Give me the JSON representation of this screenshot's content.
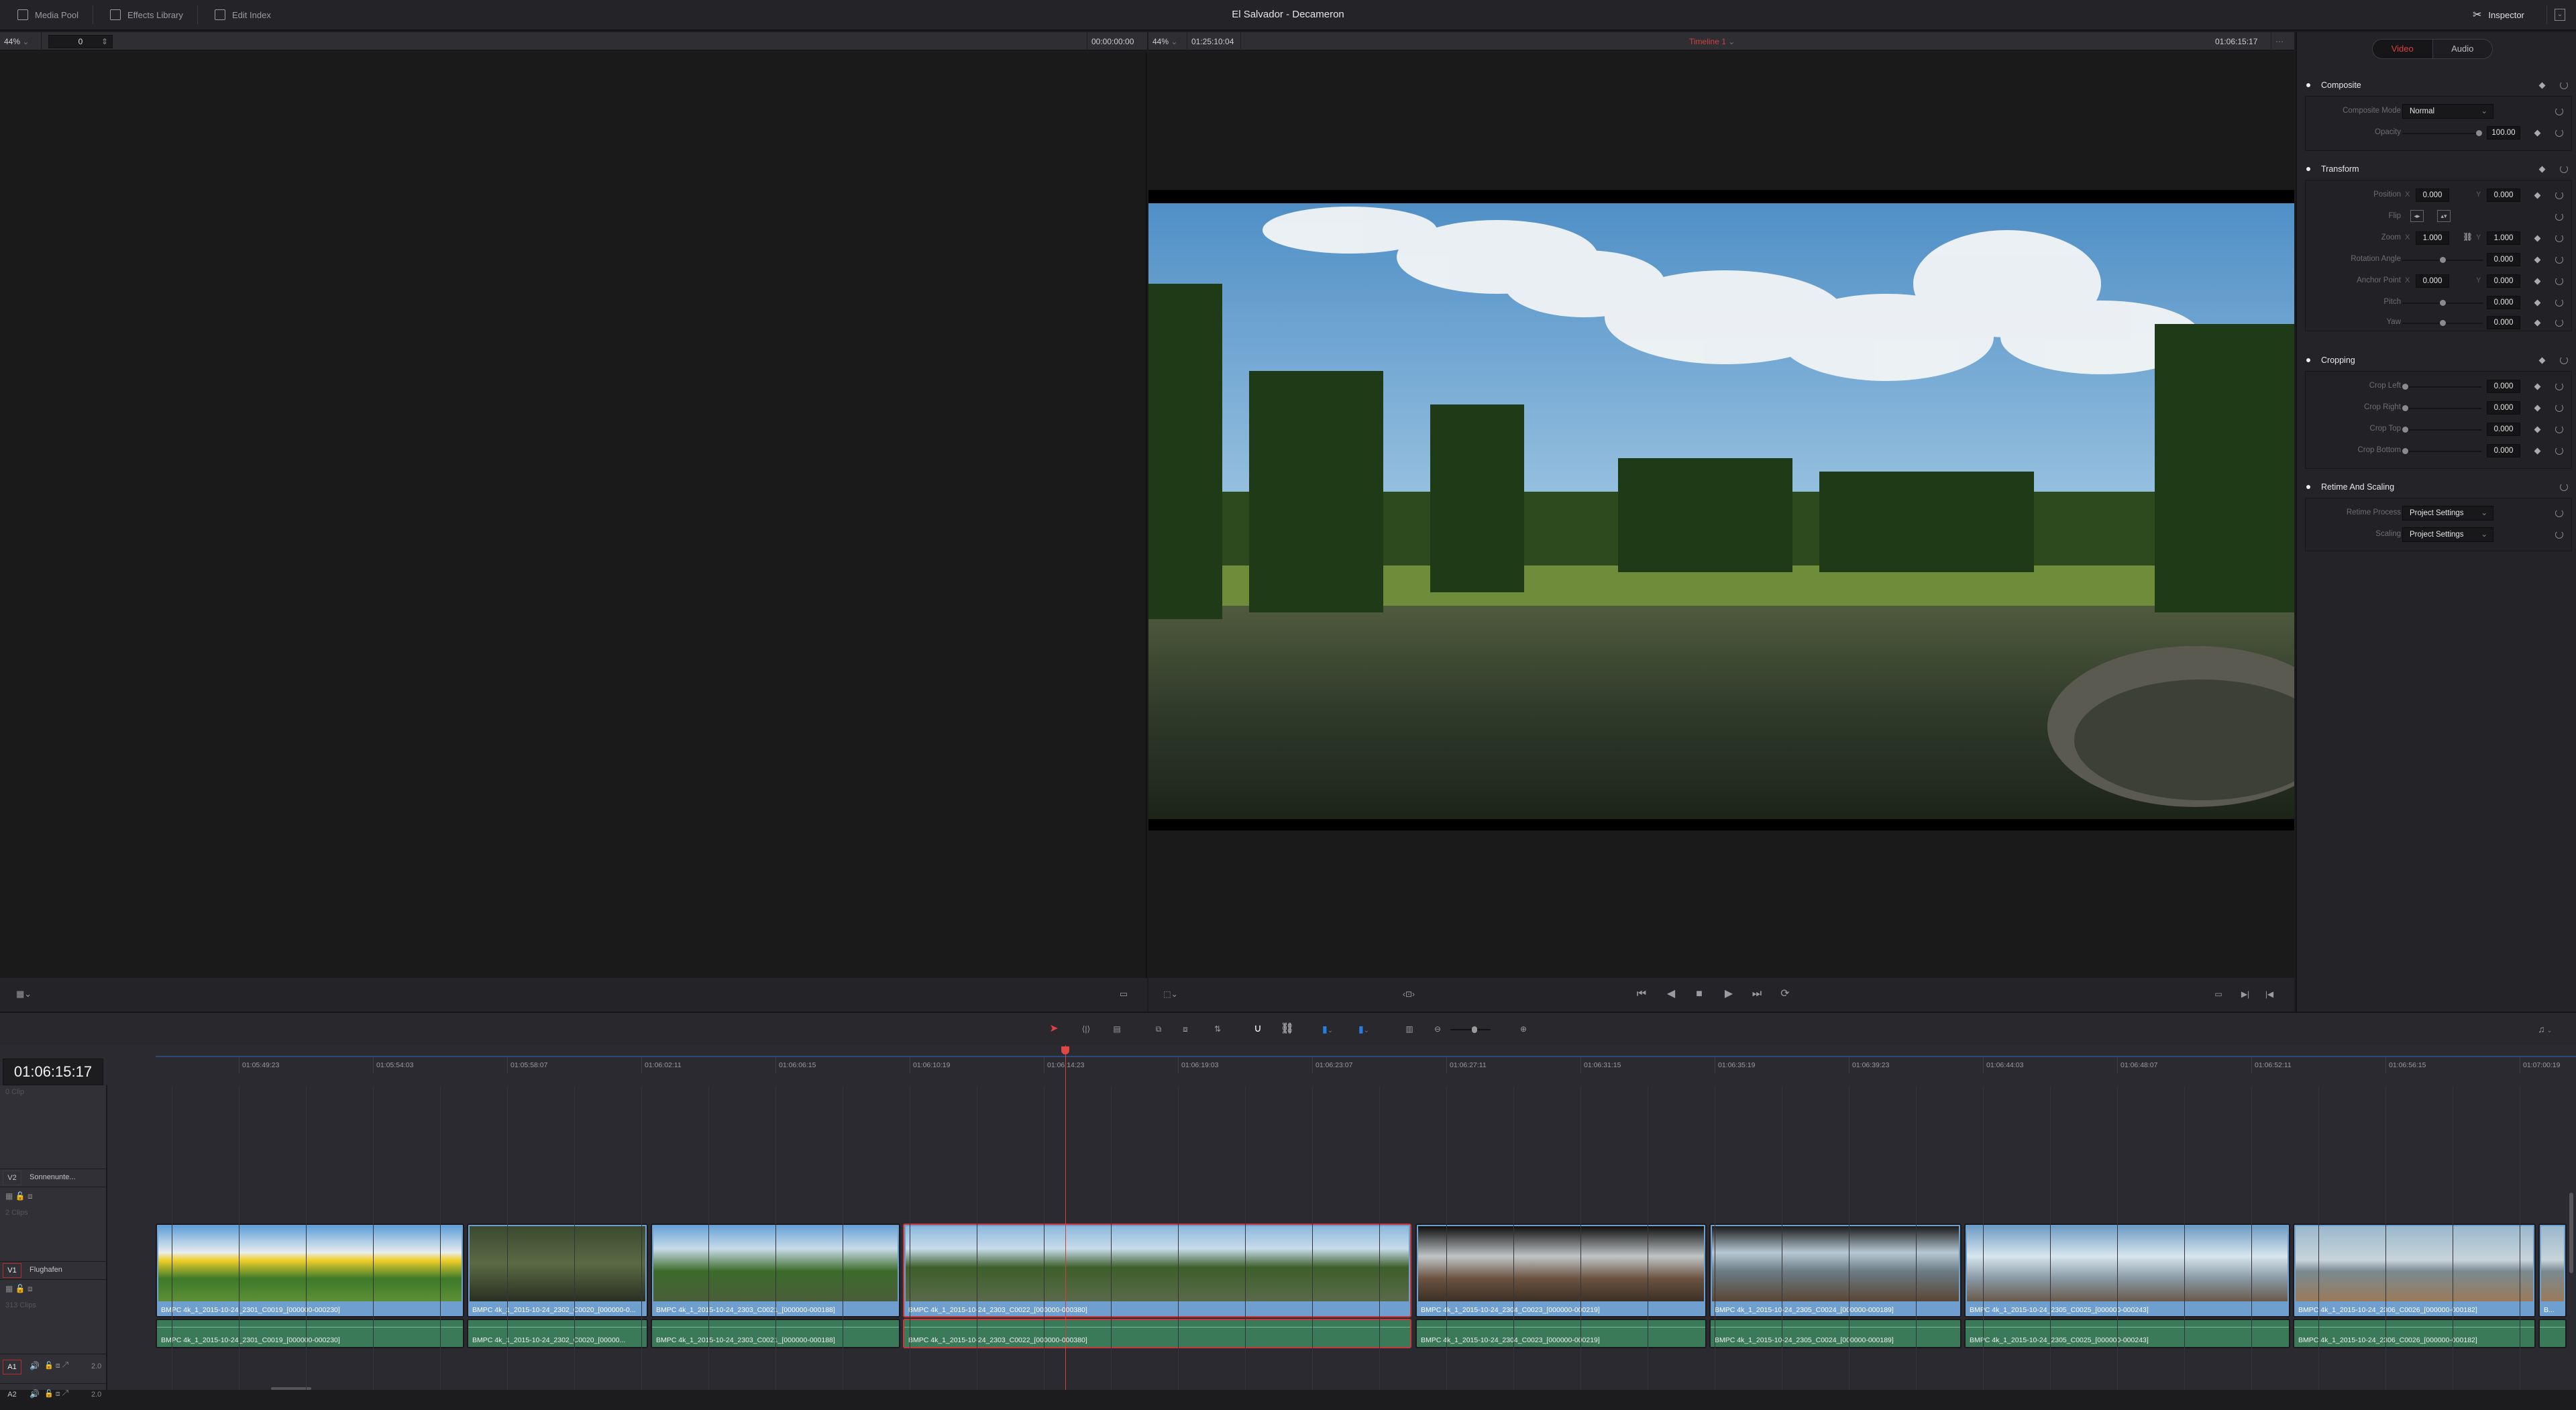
{
  "app_title": "El Salvador - Decameron",
  "topbar": {
    "left_buttons": [
      {
        "label": "Media Pool",
        "icon": "media-pool-icon"
      },
      {
        "label": "Effects Library",
        "icon": "effects-library-icon"
      },
      {
        "label": "Edit Index",
        "icon": "edit-index-icon"
      }
    ],
    "inspector_label": "Inspector"
  },
  "source_viewer": {
    "zoom": "44%",
    "frame_field": "0",
    "timecode": "00:00:00:00"
  },
  "timeline_viewer": {
    "zoom": "44%",
    "duration": "01:25:10:04",
    "timeline_name": "Timeline 1",
    "timecode": "01:06:15:17",
    "scrub_position": 0.14
  },
  "inspector": {
    "tabs": [
      {
        "label": "Video",
        "active": true
      },
      {
        "label": "Audio",
        "active": false
      }
    ],
    "composite": {
      "title": "Composite",
      "mode_label": "Composite Mode",
      "mode_value": "Normal",
      "opacity_label": "Opacity",
      "opacity_value": "100.00",
      "opacity_fraction": 1.0
    },
    "transform": {
      "title": "Transform",
      "position_label": "Position",
      "position_x": "0.000",
      "position_y": "0.000",
      "flip_label": "Flip",
      "zoom_label": "Zoom",
      "zoom_x": "1.000",
      "zoom_y": "1.000",
      "rotation_label": "Rotation Angle",
      "rotation_value": "0.000",
      "anchor_label": "Anchor Point",
      "anchor_x": "0.000",
      "anchor_y": "0.000",
      "pitch_label": "Pitch",
      "pitch_value": "0.000",
      "yaw_label": "Yaw",
      "yaw_value": "0.000",
      "x_axis": "X",
      "y_axis": "Y"
    },
    "cropping": {
      "title": "Cropping",
      "rows": [
        {
          "label": "Crop Left",
          "value": "0.000"
        },
        {
          "label": "Crop Right",
          "value": "0.000"
        },
        {
          "label": "Crop Top",
          "value": "0.000"
        },
        {
          "label": "Crop Bottom",
          "value": "0.000"
        }
      ]
    },
    "retime": {
      "title": "Retime And Scaling",
      "process_label": "Retime Process",
      "process_value": "Project Settings",
      "scaling_label": "Scaling",
      "scaling_value": "Project Settings"
    }
  },
  "timeline": {
    "current_timecode": "01:06:15:17",
    "ruler_ticks": [
      "01:05:49:23",
      "01:05:54:03",
      "01:05:58:07",
      "01:06:02:11",
      "01:06:06:15",
      "01:06:10:19",
      "01:06:14:23",
      "01:06:19:03",
      "01:06:23:07",
      "01:06:27:11",
      "01:06:31:15",
      "01:06:35:19",
      "01:06:39:23",
      "01:06:44:03",
      "01:06:48:07",
      "01:06:52:11",
      "01:06:56:15",
      "01:07:00:19"
    ],
    "tracks": {
      "v3_clips": "0 Clip",
      "v2": {
        "id": "V2",
        "name": "Sonnenunte...",
        "clips": "2 Clips"
      },
      "v1": {
        "id": "V1",
        "name": "Flughafen",
        "clips": "313 Clips"
      },
      "a1": {
        "id": "A1",
        "level": "2.0"
      },
      "a2": {
        "id": "A2",
        "level": "2.0"
      }
    },
    "clips": [
      {
        "name": "BMPC 4k_1_2015-10-24_2301_C0019_[000000-000230]",
        "audio_name": "BMPC 4k_1_2015-10-24_2301_C0019_[000000-000230]",
        "theme": "building",
        "selected": false
      },
      {
        "name": "BMPC 4k_1_2015-10-24_2302_C0020_[000000-0...",
        "audio_name": "BMPC 4k_1_2015-10-24_2302_C0020_[00000...",
        "theme": "pond-dark",
        "selected": false
      },
      {
        "name": "BMPC 4k_1_2015-10-24_2303_C0021_[000000-000188]",
        "audio_name": "BMPC 4k_1_2015-10-24_2303_C0021_[000000-000188]",
        "theme": "palms",
        "selected": false
      },
      {
        "name": "BMPC 4k_1_2015-10-24_2303_C0022_[000000-000380]",
        "audio_name": "BMPC 4k_1_2015-10-24_2303_C0022_[000000-000380]",
        "theme": "pond",
        "selected": true
      },
      {
        "name": "BMPC 4k_1_2015-10-24_2304_C0023_[000000-000219]",
        "audio_name": "BMPC 4k_1_2015-10-24_2304_C0023_[000000-000219]",
        "theme": "beach-dark",
        "selected": false
      },
      {
        "name": "BMPC 4k_1_2015-10-24_2305_C0024_[000000-000189]",
        "audio_name": "BMPC 4k_1_2015-10-24_2305_C0024_[000000-000189]",
        "theme": "sea",
        "selected": false
      },
      {
        "name": "BMPC 4k_1_2015-10-24_2305_C0025_[000000-000243]",
        "audio_name": "BMPC 4k_1_2015-10-24_2305_C0025_[000000-000243]",
        "theme": "sky",
        "selected": false
      },
      {
        "name": "BMPC 4k_1_2015-10-24_2306_C0026_[000000-000182]",
        "audio_name": "BMPC 4k_1_2015-10-24_2306_C0026_[000000-000182]",
        "theme": "beach",
        "selected": false
      },
      {
        "name": "B...",
        "audio_name": "",
        "theme": "beach",
        "selected": false
      }
    ]
  }
}
